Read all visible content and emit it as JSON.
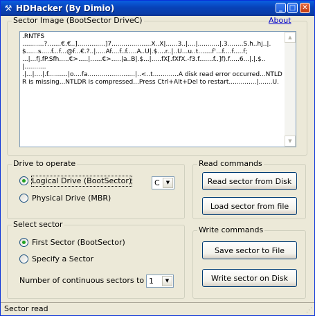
{
  "window": {
    "title": "HDHacker (By Dimio)",
    "icon": "hammer-icon",
    "controls": {
      "minimize": "_",
      "maximize": "□",
      "close": "✕"
    }
  },
  "sector_image": {
    "label": "Sector Image (BootSector DriveC)",
    "about_link": "About",
    "content": ".RNTFS\n...........?.......€.€..]..............]7....................X..X|......3..|....|...........|.3........S.h..hj..|.\n$......s.....f...f...@f...€.?..|.....Af....f..f.....A..U|.$....r..|..U...u..t.......f'...f....f.....f;\n...|...fj.fP.Sfh.....€>.....|......€>.....|a..B|.$...|.....fX[.fXfX.-f3.f.......f..]f).f.....6...|.|.$..|...........\n.|...|....|.f..........|o....fa........................|..<..t.............A disk read error occurred...NTLDR is missing...NTLDR is compressed...Press Ctrl+Alt+Del to restart..............|.......U."
  },
  "drive": {
    "label": "Drive to operate",
    "option_logical": "Logical Drive (BootSector)",
    "option_physical": "Physical Drive (MBR)",
    "selected": "logical",
    "drive_letter": "C"
  },
  "select_sector": {
    "label": "Select sector",
    "option_first": "First Sector (BootSector)",
    "option_specify": "Specify a Sector",
    "selected": "first",
    "count_label": "Number of continuous sectors to read",
    "count_value": "1"
  },
  "read_commands": {
    "label": "Read commands",
    "read_disk": "Read sector from Disk",
    "load_file": "Load sector from file"
  },
  "write_commands": {
    "label": "Write commands",
    "save_file": "Save sector to File",
    "write_disk": "Write sector on Disk"
  },
  "status": {
    "text": "Sector read"
  }
}
